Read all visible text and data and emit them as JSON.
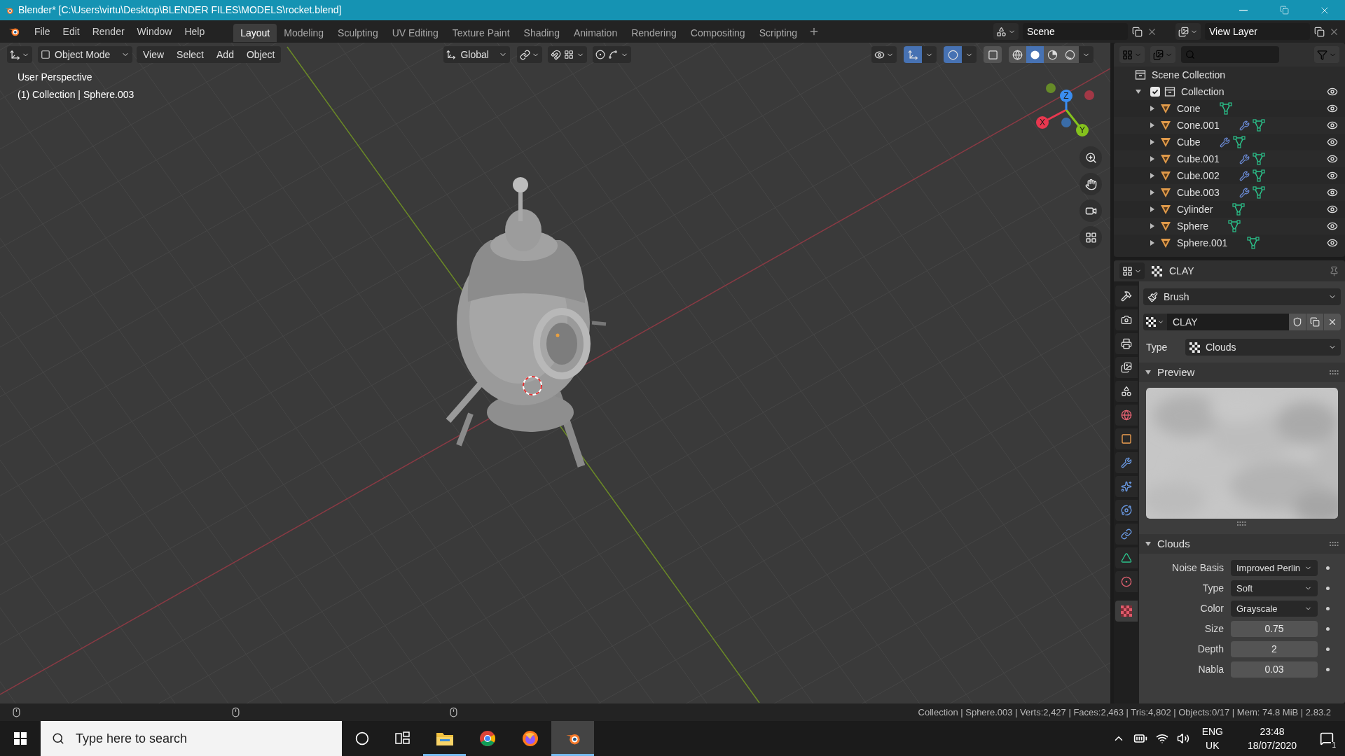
{
  "window": {
    "title": "Blender* [C:\\Users\\virtu\\Desktop\\BLENDER FILES\\MODELS\\rocket.blend]"
  },
  "menus": [
    "File",
    "Edit",
    "Render",
    "Window",
    "Help"
  ],
  "workspaces": [
    {
      "label": "Layout",
      "selected": true
    },
    {
      "label": "Modeling",
      "selected": false
    },
    {
      "label": "Sculpting",
      "selected": false
    },
    {
      "label": "UV Editing",
      "selected": false
    },
    {
      "label": "Texture Paint",
      "selected": false
    },
    {
      "label": "Shading",
      "selected": false
    },
    {
      "label": "Animation",
      "selected": false
    },
    {
      "label": "Rendering",
      "selected": false
    },
    {
      "label": "Compositing",
      "selected": false
    },
    {
      "label": "Scripting",
      "selected": false
    }
  ],
  "scene": {
    "name": "Scene"
  },
  "view_layer": {
    "name": "View Layer"
  },
  "viewport": {
    "mode": "Object Mode",
    "menus": [
      "View",
      "Select",
      "Add",
      "Object"
    ],
    "orientation": "Global",
    "toggles": [
      {
        "kind": "gizmo",
        "on": true
      },
      {
        "kind": "overlay",
        "on": true
      },
      {
        "kind": "xray",
        "on": false
      }
    ],
    "shading": [
      {
        "kind": "wireframe",
        "selected": false
      },
      {
        "kind": "solid",
        "selected": true
      },
      {
        "kind": "material",
        "selected": false
      },
      {
        "kind": "rendered",
        "selected": false
      }
    ],
    "overlay_text": [
      "User Perspective",
      "(1) Collection | Sphere.003"
    ],
    "gizmo_axes": [
      {
        "label": "X",
        "color": "#e8374f"
      },
      {
        "label": "Y",
        "color": "#84c21d"
      },
      {
        "label": "Z",
        "color": "#3a8df0"
      }
    ]
  },
  "outliner": {
    "root": "Scene Collection",
    "items": [
      {
        "name": "Collection",
        "kind": "collection",
        "checked": true,
        "expanded": true,
        "visible": true,
        "children": [
          {
            "name": "Cone",
            "kind": "object",
            "expanded": false,
            "modifier": false,
            "visible": true
          },
          {
            "name": "Cone.001",
            "kind": "object",
            "expanded": false,
            "modifier": true,
            "visible": true
          },
          {
            "name": "Cube",
            "kind": "object",
            "expanded": false,
            "modifier": true,
            "visible": true
          },
          {
            "name": "Cube.001",
            "kind": "object",
            "expanded": false,
            "modifier": true,
            "visible": true
          },
          {
            "name": "Cube.002",
            "kind": "object",
            "expanded": false,
            "modifier": true,
            "visible": true
          },
          {
            "name": "Cube.003",
            "kind": "object",
            "expanded": false,
            "modifier": true,
            "visible": true
          },
          {
            "name": "Cylinder",
            "kind": "object",
            "expanded": false,
            "modifier": false,
            "visible": true
          },
          {
            "name": "Sphere",
            "kind": "object",
            "expanded": false,
            "modifier": false,
            "visible": true
          },
          {
            "name": "Sphere.001",
            "kind": "object",
            "expanded": false,
            "modifier": false,
            "visible": true
          }
        ]
      }
    ]
  },
  "properties": {
    "context": "CLAY",
    "tabs": [
      {
        "kind": "tool",
        "selected": false
      },
      {
        "kind": "render",
        "selected": false
      },
      {
        "kind": "output",
        "selected": false
      },
      {
        "kind": "view_layer",
        "selected": false
      },
      {
        "kind": "scene",
        "selected": false
      },
      {
        "kind": "world",
        "selected": false
      },
      {
        "kind": "object",
        "selected": false
      },
      {
        "kind": "modifier",
        "selected": false
      },
      {
        "kind": "particles",
        "selected": false
      },
      {
        "kind": "physics",
        "selected": false
      },
      {
        "kind": "constraints",
        "selected": false
      },
      {
        "kind": "data",
        "selected": false
      },
      {
        "kind": "material",
        "selected": false
      },
      {
        "kind": "texture",
        "selected": true
      }
    ],
    "brush": "Brush",
    "texture": "CLAY",
    "type": {
      "label": "Type",
      "value": "Clouds"
    },
    "panels": [
      {
        "title": "Preview",
        "kind": "preview",
        "expanded": true
      },
      {
        "title": "Clouds",
        "kind": "fields",
        "expanded": true,
        "fields": [
          {
            "label": "Noise Basis",
            "value": "Improved Perlin",
            "kind": "dropdown"
          },
          {
            "label": "Type",
            "value": "Soft",
            "kind": "dropdown"
          },
          {
            "label": "Color",
            "value": "Grayscale",
            "kind": "dropdown"
          },
          {
            "label": "Size",
            "value": "0.75",
            "kind": "number"
          },
          {
            "label": "Depth",
            "value": "2",
            "kind": "number"
          },
          {
            "label": "Nabla",
            "value": "0.03",
            "kind": "number"
          }
        ]
      }
    ]
  },
  "status_bar": {
    "text": "Collection | Sphere.003 | Verts:2,427 | Faces:2,463 | Tris:4,802 | Objects:0/17 | Mem: 74.8 MiB | 2.83.2"
  },
  "taskbar": {
    "search": {
      "placeholder": "Type here to search"
    },
    "apps": [
      {
        "kind": "folder",
        "running": true,
        "selected": false
      },
      {
        "kind": "chrome",
        "running": false,
        "selected": false
      },
      {
        "kind": "firefox",
        "running": false,
        "selected": false
      },
      {
        "kind": "blender",
        "running": true,
        "selected": true
      }
    ],
    "language": [
      "ENG",
      "UK"
    ],
    "time": "23:48",
    "date": "18/07/2020",
    "notifications": "1"
  }
}
